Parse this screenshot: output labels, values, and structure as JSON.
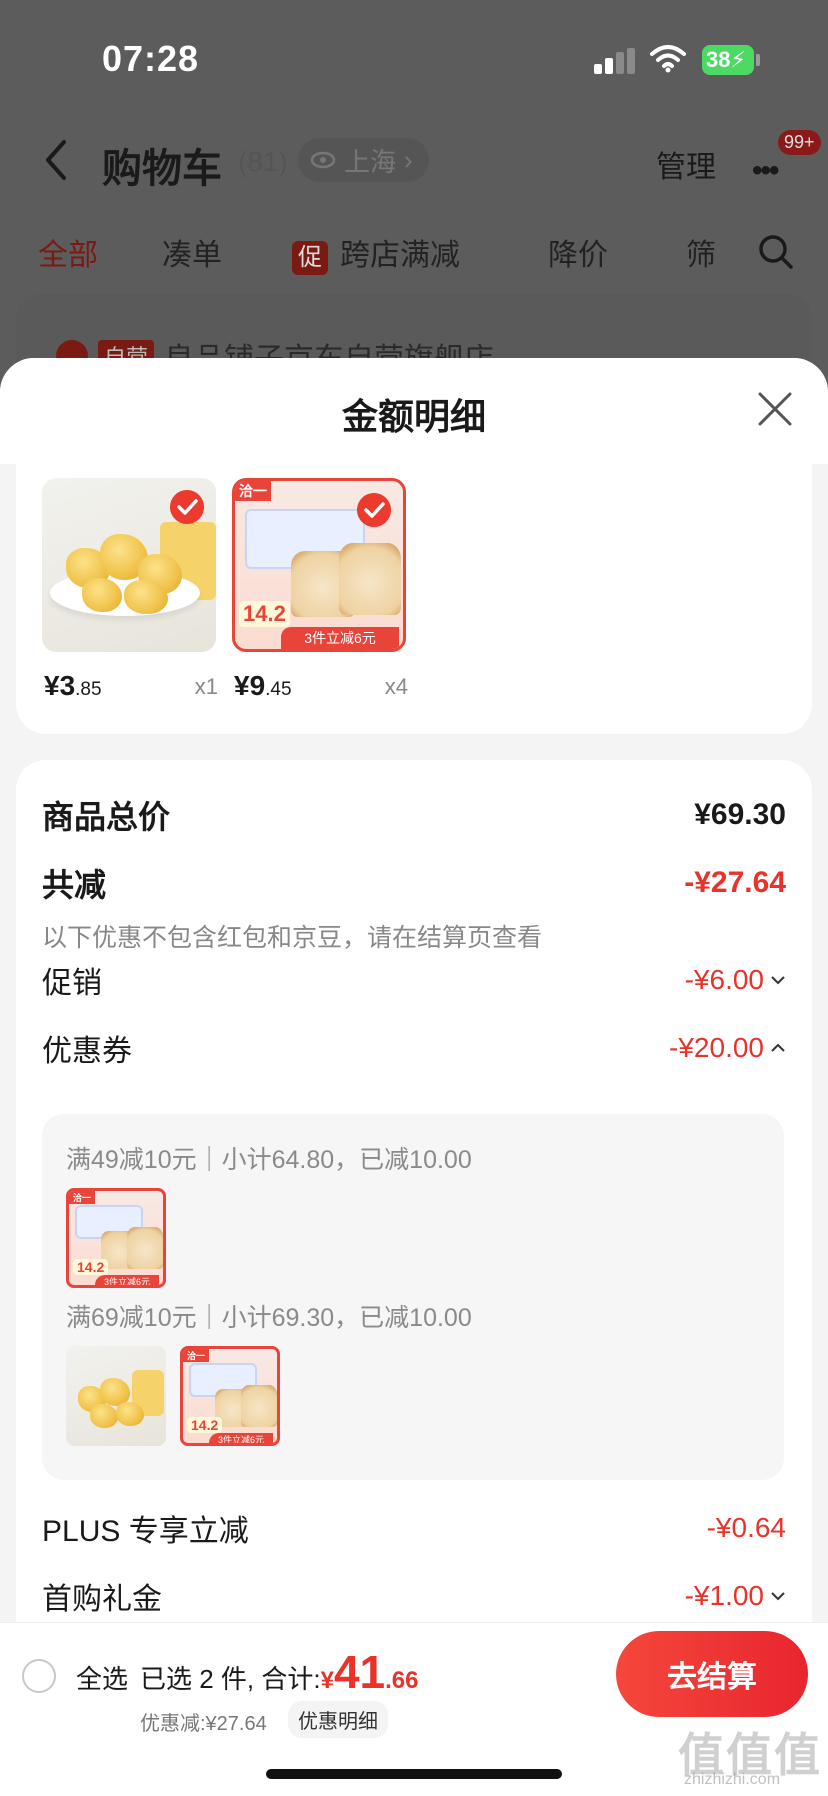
{
  "status": {
    "time": "07:28",
    "battery": "38"
  },
  "nav": {
    "title": "购物车",
    "count": "(81)",
    "location": "上海",
    "manage": "管理",
    "badge": "99+"
  },
  "filters": {
    "tabs": [
      "全部",
      "凑单",
      "跨店满减",
      "降价",
      "筛"
    ],
    "promo_tag": "促"
  },
  "store_peek": {
    "tag": "自营",
    "name": "良品铺子京东自营旗舰店"
  },
  "sheet": {
    "title": "金额明细"
  },
  "products": [
    {
      "price_symbol": "¥",
      "price_int": "3",
      "price_dec": ".85",
      "qty": "x1"
    },
    {
      "price_symbol": "¥",
      "price_int": "9",
      "price_dec": ".45",
      "qty": "x4"
    }
  ],
  "bread_image": {
    "tag": "洽一",
    "price": "14.2",
    "band": "3件立减6元"
  },
  "details": {
    "total_label": "商品总价",
    "total_value": "¥69.30",
    "discount_label": "共减",
    "discount_value": "-¥27.64",
    "note": "以下优惠不包含红包和京豆，请在结算页查看",
    "promo_label": "促销",
    "promo_value": "-¥6.00",
    "coupon_label": "优惠券",
    "coupon_value": "-¥20.00",
    "coupon_lines": [
      "满49减10元｜小计64.80，已减10.00",
      "满69减10元｜小计69.30，已减10.00"
    ],
    "plus_label": "PLUS 专享立减",
    "plus_value": "-¥0.64",
    "firstbuy_label": "首购礼金",
    "firstbuy_value": "-¥1.00"
  },
  "bottom": {
    "select_all": "全选",
    "selected": "已选 2 件, 合计:",
    "total_symbol": "¥",
    "total_int": "41",
    "total_dec": ".66",
    "saved": "优惠减:¥27.64",
    "detail_link": "优惠明细",
    "checkout": "去结算"
  },
  "watermark": {
    "main": "值值值",
    "sub": "zhizhizhi.com"
  },
  "colors": {
    "accent": "#e8322a",
    "checkout": "#f5473b",
    "dim_overlay": "#5c5c5c"
  }
}
